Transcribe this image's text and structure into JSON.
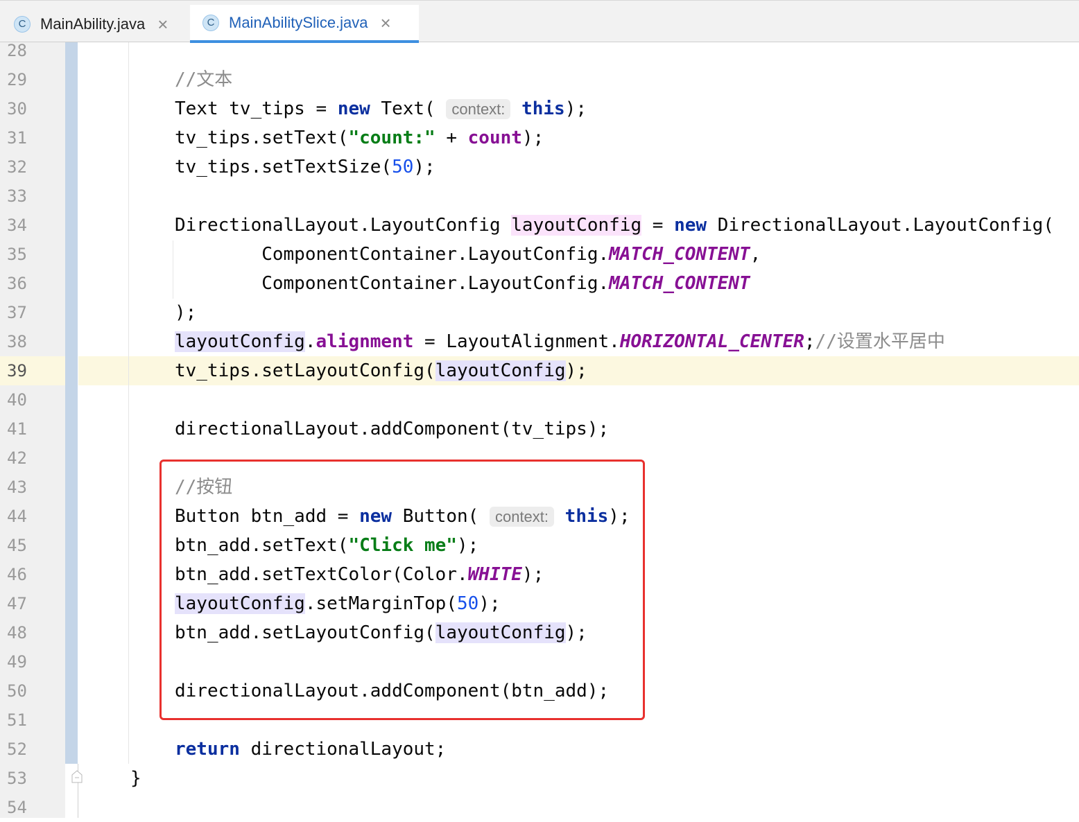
{
  "tabs": [
    {
      "label": "MainAbility.java",
      "icon": "C",
      "active": false
    },
    {
      "label": "MainAbilitySlice.java",
      "icon": "C",
      "active": true
    }
  ],
  "line_numbers": [
    "28",
    "29",
    "30",
    "31",
    "32",
    "33",
    "34",
    "35",
    "36",
    "37",
    "38",
    "39",
    "40",
    "41",
    "42",
    "43",
    "44",
    "45",
    "46",
    "47",
    "48",
    "49",
    "50",
    "51",
    "52",
    "53",
    "54"
  ],
  "current_line": "39",
  "code": {
    "l29": {
      "comment": "//文本"
    },
    "l30": {
      "a": "Text tv_tips = ",
      "kw_new": "new",
      "b": " Text(",
      "hint": "context:",
      "kw_this": "this",
      "c": ");"
    },
    "l31": {
      "a": "tv_tips.setText(",
      "str": "\"count:\"",
      "b": " + ",
      "field": "count",
      "c": ");"
    },
    "l32": {
      "a": "tv_tips.setTextSize(",
      "num": "50",
      "b": ");"
    },
    "l34": {
      "a": "DirectionalLayout.LayoutConfig ",
      "var": "layoutConfig",
      "b": " = ",
      "kw_new": "new",
      "c": " DirectionalLayout.LayoutConfig("
    },
    "l35": {
      "a": "        ComponentContainer.LayoutConfig.",
      "const": "MATCH_CONTENT",
      "b": ","
    },
    "l36": {
      "a": "        ComponentContainer.LayoutConfig.",
      "const": "MATCH_CONTENT"
    },
    "l37": {
      "a": ");"
    },
    "l38": {
      "var": "layoutConfig",
      "a": ".",
      "field": "alignment",
      "b": " = LayoutAlignment.",
      "const": "HORIZONTAL_CENTER",
      "c": ";",
      "comment": "//设置水平居中"
    },
    "l39": {
      "a": "tv_tips.setLayoutConfig(",
      "var": "layoutConfig",
      "b": ");"
    },
    "l41": {
      "a": "directionalLayout.addComponent(tv_tips);"
    },
    "l43": {
      "comment": "//按钮"
    },
    "l44": {
      "a": "Button btn_add = ",
      "kw_new": "new",
      "b": " Button(",
      "hint": "context:",
      "kw_this": "this",
      "c": ");"
    },
    "l45": {
      "a": "btn_add.setText(",
      "str": "\"Click me\"",
      "b": ");"
    },
    "l46": {
      "a": "btn_add.setTextColor(Color.",
      "const": "WHITE",
      "b": ");"
    },
    "l47": {
      "var": "layoutConfig",
      "a": ".setMarginTop(",
      "num": "50",
      "b": ");"
    },
    "l48": {
      "a": "btn_add.setLayoutConfig(",
      "var": "layoutConfig",
      "b": ");"
    },
    "l50": {
      "a": "directionalLayout.addComponent(btn_add);"
    },
    "l52": {
      "kw_return": "return",
      "a": " directionalLayout;"
    },
    "l53": {
      "a": "}"
    }
  },
  "colors": {
    "highlight_box": "#e8312e",
    "current_line_bg": "#fcf8e0",
    "keyword": "#0b2f9f",
    "string": "#077d17",
    "number": "#1750eb",
    "field": "#871094",
    "active_tab_underline": "#3d8fe0"
  }
}
